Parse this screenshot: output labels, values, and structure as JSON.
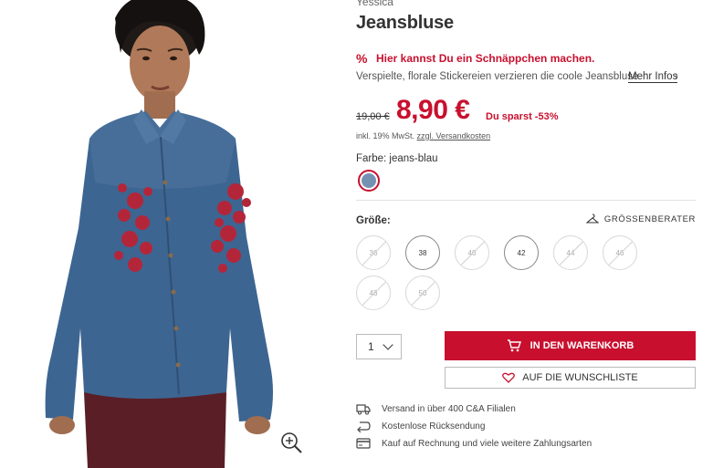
{
  "product": {
    "brand": "Yessica",
    "title": "Jeansbluse",
    "deal_text": "Hier kannst Du ein Schnäppchen machen.",
    "description": "Verspielte, florale Stickereien verzieren die coole Jeansbluse",
    "more_info": "Mehr Infos",
    "old_price": "19,00 €",
    "price": "8,90 €",
    "savings": "Du sparst -53%",
    "tax_note": "inkl. 19% MwSt.",
    "shipping_link": "zzgl. Versandkosten",
    "color_label": "Farbe: jeans-blau",
    "color_hex": "#7591b2",
    "accent": "#c8102e"
  },
  "sizing": {
    "label": "Größe:",
    "guide": "GRÖSSENBERATER",
    "sizes": [
      {
        "label": "36",
        "available": false
      },
      {
        "label": "38",
        "available": true
      },
      {
        "label": "40",
        "available": false
      },
      {
        "label": "42",
        "available": true
      },
      {
        "label": "44",
        "available": false
      },
      {
        "label": "46",
        "available": false
      },
      {
        "label": "48",
        "available": false
      },
      {
        "label": "50",
        "available": false
      }
    ]
  },
  "purchase": {
    "quantity": "1",
    "cart_label": "IN DEN WARENKORB",
    "wishlist_label": "AUF DIE WUNSCHLISTE"
  },
  "features": [
    {
      "icon": "truck-icon",
      "text": "Versand in über 400 C&A Filialen"
    },
    {
      "icon": "return-icon",
      "text": "Kostenlose Rücksendung"
    },
    {
      "icon": "card-icon",
      "text": "Kauf auf Rechnung und viele weitere Zahlungsarten"
    }
  ]
}
